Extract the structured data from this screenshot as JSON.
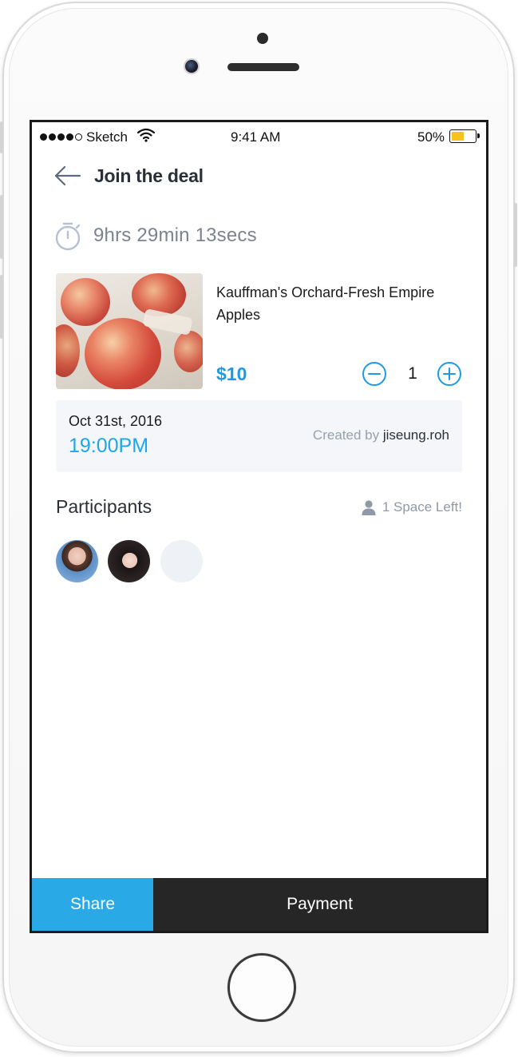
{
  "status_bar": {
    "carrier": "Sketch",
    "time": "9:41 AM",
    "battery": "50%",
    "signal_icon": "signal-dots-icon",
    "wifi_icon": "wifi-icon",
    "battery_icon": "battery-icon",
    "battery_level": 0.5
  },
  "header": {
    "title": "Join the deal",
    "back_icon": "arrow-left-icon"
  },
  "timer": {
    "icon": "stopwatch-icon",
    "text": "9hrs 29min 13secs"
  },
  "product": {
    "name": "Kauffman's Orchard-Fresh Empire Apples",
    "price": "$10",
    "quantity": "1",
    "minus_icon": "minus-circle-icon",
    "plus_icon": "plus-circle-icon"
  },
  "deal_info": {
    "date": "Oct 31st, 2016",
    "time": "19:00PM",
    "created_by_label": "Created by",
    "creator": "jiseung.roh"
  },
  "participants": {
    "title": "Participants",
    "space_left": "1 Space Left!",
    "space_icon": "user-icon",
    "avatars": [
      "avatar-user-1",
      "avatar-user-2",
      "avatar-empty-slot"
    ]
  },
  "actions": {
    "share": "Share",
    "payment": "Payment"
  },
  "colors": {
    "accent": "#1d9ae3",
    "share_bg": "#29aae6",
    "payment_bg": "#262626",
    "info_bg": "#f4f6f9"
  }
}
